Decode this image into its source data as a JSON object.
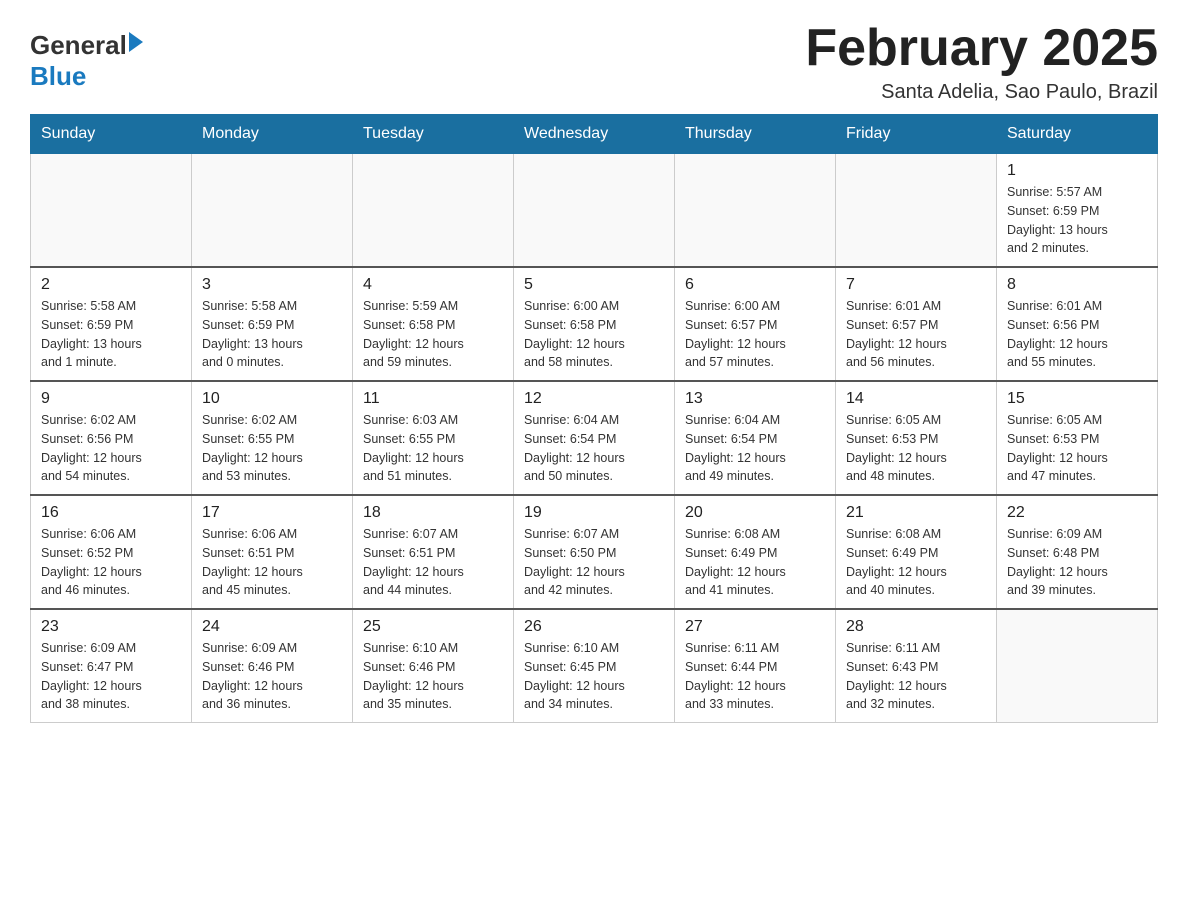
{
  "header": {
    "logo": {
      "general": "General",
      "blue": "Blue"
    },
    "title": "February 2025",
    "subtitle": "Santa Adelia, Sao Paulo, Brazil"
  },
  "days_of_week": [
    "Sunday",
    "Monday",
    "Tuesday",
    "Wednesday",
    "Thursday",
    "Friday",
    "Saturday"
  ],
  "weeks": [
    [
      {
        "day": "",
        "info": ""
      },
      {
        "day": "",
        "info": ""
      },
      {
        "day": "",
        "info": ""
      },
      {
        "day": "",
        "info": ""
      },
      {
        "day": "",
        "info": ""
      },
      {
        "day": "",
        "info": ""
      },
      {
        "day": "1",
        "info": "Sunrise: 5:57 AM\nSunset: 6:59 PM\nDaylight: 13 hours\nand 2 minutes."
      }
    ],
    [
      {
        "day": "2",
        "info": "Sunrise: 5:58 AM\nSunset: 6:59 PM\nDaylight: 13 hours\nand 1 minute."
      },
      {
        "day": "3",
        "info": "Sunrise: 5:58 AM\nSunset: 6:59 PM\nDaylight: 13 hours\nand 0 minutes."
      },
      {
        "day": "4",
        "info": "Sunrise: 5:59 AM\nSunset: 6:58 PM\nDaylight: 12 hours\nand 59 minutes."
      },
      {
        "day": "5",
        "info": "Sunrise: 6:00 AM\nSunset: 6:58 PM\nDaylight: 12 hours\nand 58 minutes."
      },
      {
        "day": "6",
        "info": "Sunrise: 6:00 AM\nSunset: 6:57 PM\nDaylight: 12 hours\nand 57 minutes."
      },
      {
        "day": "7",
        "info": "Sunrise: 6:01 AM\nSunset: 6:57 PM\nDaylight: 12 hours\nand 56 minutes."
      },
      {
        "day": "8",
        "info": "Sunrise: 6:01 AM\nSunset: 6:56 PM\nDaylight: 12 hours\nand 55 minutes."
      }
    ],
    [
      {
        "day": "9",
        "info": "Sunrise: 6:02 AM\nSunset: 6:56 PM\nDaylight: 12 hours\nand 54 minutes."
      },
      {
        "day": "10",
        "info": "Sunrise: 6:02 AM\nSunset: 6:55 PM\nDaylight: 12 hours\nand 53 minutes."
      },
      {
        "day": "11",
        "info": "Sunrise: 6:03 AM\nSunset: 6:55 PM\nDaylight: 12 hours\nand 51 minutes."
      },
      {
        "day": "12",
        "info": "Sunrise: 6:04 AM\nSunset: 6:54 PM\nDaylight: 12 hours\nand 50 minutes."
      },
      {
        "day": "13",
        "info": "Sunrise: 6:04 AM\nSunset: 6:54 PM\nDaylight: 12 hours\nand 49 minutes."
      },
      {
        "day": "14",
        "info": "Sunrise: 6:05 AM\nSunset: 6:53 PM\nDaylight: 12 hours\nand 48 minutes."
      },
      {
        "day": "15",
        "info": "Sunrise: 6:05 AM\nSunset: 6:53 PM\nDaylight: 12 hours\nand 47 minutes."
      }
    ],
    [
      {
        "day": "16",
        "info": "Sunrise: 6:06 AM\nSunset: 6:52 PM\nDaylight: 12 hours\nand 46 minutes."
      },
      {
        "day": "17",
        "info": "Sunrise: 6:06 AM\nSunset: 6:51 PM\nDaylight: 12 hours\nand 45 minutes."
      },
      {
        "day": "18",
        "info": "Sunrise: 6:07 AM\nSunset: 6:51 PM\nDaylight: 12 hours\nand 44 minutes."
      },
      {
        "day": "19",
        "info": "Sunrise: 6:07 AM\nSunset: 6:50 PM\nDaylight: 12 hours\nand 42 minutes."
      },
      {
        "day": "20",
        "info": "Sunrise: 6:08 AM\nSunset: 6:49 PM\nDaylight: 12 hours\nand 41 minutes."
      },
      {
        "day": "21",
        "info": "Sunrise: 6:08 AM\nSunset: 6:49 PM\nDaylight: 12 hours\nand 40 minutes."
      },
      {
        "day": "22",
        "info": "Sunrise: 6:09 AM\nSunset: 6:48 PM\nDaylight: 12 hours\nand 39 minutes."
      }
    ],
    [
      {
        "day": "23",
        "info": "Sunrise: 6:09 AM\nSunset: 6:47 PM\nDaylight: 12 hours\nand 38 minutes."
      },
      {
        "day": "24",
        "info": "Sunrise: 6:09 AM\nSunset: 6:46 PM\nDaylight: 12 hours\nand 36 minutes."
      },
      {
        "day": "25",
        "info": "Sunrise: 6:10 AM\nSunset: 6:46 PM\nDaylight: 12 hours\nand 35 minutes."
      },
      {
        "day": "26",
        "info": "Sunrise: 6:10 AM\nSunset: 6:45 PM\nDaylight: 12 hours\nand 34 minutes."
      },
      {
        "day": "27",
        "info": "Sunrise: 6:11 AM\nSunset: 6:44 PM\nDaylight: 12 hours\nand 33 minutes."
      },
      {
        "day": "28",
        "info": "Sunrise: 6:11 AM\nSunset: 6:43 PM\nDaylight: 12 hours\nand 32 minutes."
      },
      {
        "day": "",
        "info": ""
      }
    ]
  ]
}
